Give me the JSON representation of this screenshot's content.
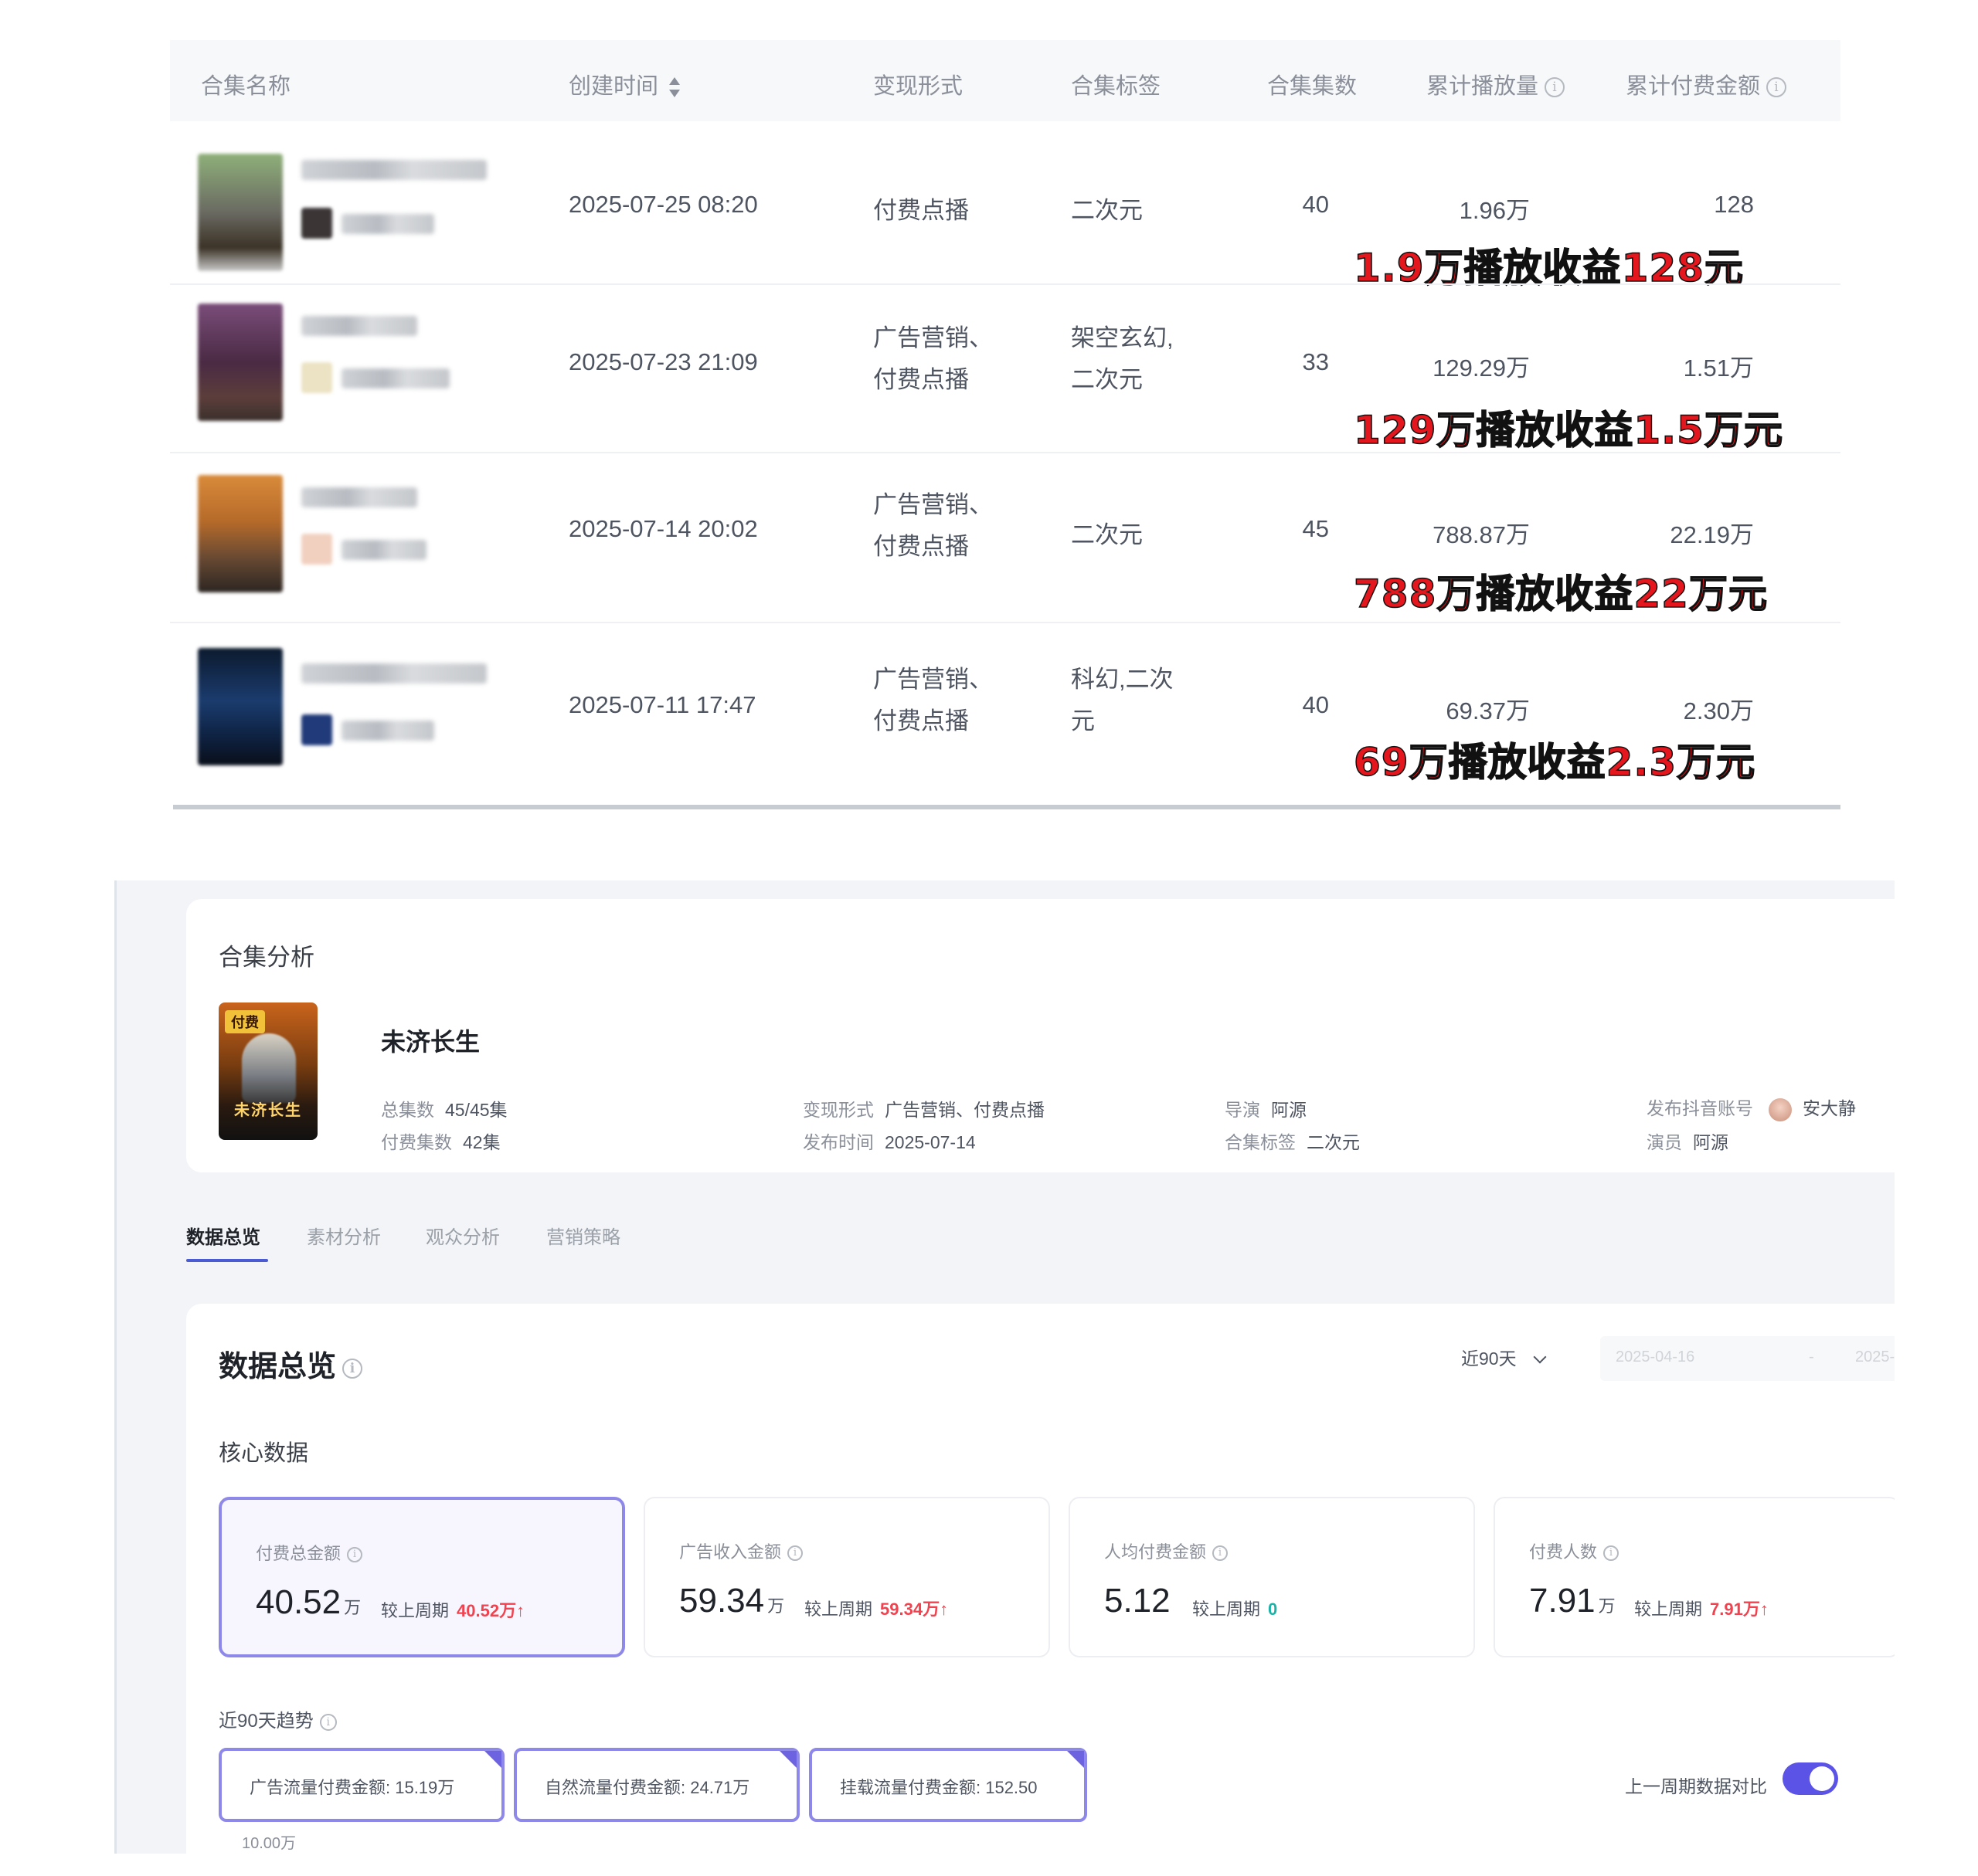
{
  "table": {
    "headers": [
      "合集名称",
      "创建时间",
      "变现形式",
      "合集标签",
      "合集集数",
      "累计播放量",
      "累计付费金额"
    ],
    "rows": [
      {
        "created": "2025-07-25 08:20",
        "monetization": [
          "付费点播"
        ],
        "tags": [
          "二次元"
        ],
        "episodes": "40",
        "plays": "1.96万",
        "paid": "128",
        "note": {
          "plays": "1.9万",
          "mid": "播放收益",
          "income": "128元"
        }
      },
      {
        "created": "2025-07-23 21:09",
        "monetization": [
          "广告营销、",
          "付费点播"
        ],
        "tags": [
          "架空玄幻,",
          "二次元"
        ],
        "episodes": "33",
        "plays": "129.29万",
        "paid": "1.51万",
        "note": {
          "plays": "129万",
          "mid": "播放收益",
          "income": "1.5万元"
        }
      },
      {
        "created": "2025-07-14 20:02",
        "monetization": [
          "广告营销、",
          "付费点播"
        ],
        "tags": [
          "二次元"
        ],
        "episodes": "45",
        "plays": "788.87万",
        "paid": "22.19万",
        "note": {
          "plays": "788万",
          "mid": "播放收益",
          "income": "22万元"
        }
      },
      {
        "created": "2025-07-11 17:47",
        "monetization": [
          "广告营销、",
          "付费点播"
        ],
        "tags": [
          "科幻,二次",
          "元"
        ],
        "episodes": "40",
        "plays": "69.37万",
        "paid": "2.30万",
        "note": {
          "plays": "69万",
          "mid": "播放收益",
          "income": "2.3万元"
        }
      }
    ]
  },
  "analysis": {
    "title": "合集分析",
    "poster_tag": "付费",
    "poster_title": "未济长生",
    "drama_title": "未济长生",
    "meta": {
      "total_eps_label": "总集数",
      "total_eps": "45/45集",
      "paid_eps_label": "付费集数",
      "paid_eps": "42集",
      "monetization_label": "变现形式",
      "monetization": "广告营销、付费点播",
      "publish_label": "发布时间",
      "publish": "2025-07-14",
      "director_label": "导演",
      "director": "阿源",
      "tag_label": "合集标签",
      "tag": "二次元",
      "account_label": "发布抖音账号",
      "account": "安大静",
      "actor_label": "演员",
      "actor": "阿源"
    }
  },
  "tabs": [
    "数据总览",
    "素材分析",
    "观众分析",
    "营销策略"
  ],
  "overview": {
    "title": "数据总览",
    "range": "近90天",
    "date_start": "2025-04-16",
    "date_sep": "-",
    "date_end": "2025-(",
    "core_title": "核心数据",
    "metrics": [
      {
        "label": "付费总金额",
        "value": "40.52",
        "unit": "万",
        "cmp_label": "较上周期",
        "cmp": "40.52万↑",
        "color": "#f0434f"
      },
      {
        "label": "广告收入金额",
        "value": "59.34",
        "unit": "万",
        "cmp_label": "较上周期",
        "cmp": "59.34万↑",
        "color": "#f0434f"
      },
      {
        "label": "人均付费金额",
        "value": "5.12",
        "unit": "",
        "cmp_label": "较上周期",
        "cmp": "0",
        "color": "#1bb3a8"
      },
      {
        "label": "付费人数",
        "value": "7.91",
        "unit": "万",
        "cmp_label": "较上周期",
        "cmp": "7.91万↑",
        "color": "#f0434f"
      }
    ],
    "trend_title": "近90天趋势",
    "pills": [
      "广告流量付费金额: 15.19万",
      "自然流量付费金额: 24.71万",
      "挂载流量付费金额: 152.50"
    ],
    "compare_label": "上一周期数据对比",
    "axis_label": "10.00万"
  }
}
